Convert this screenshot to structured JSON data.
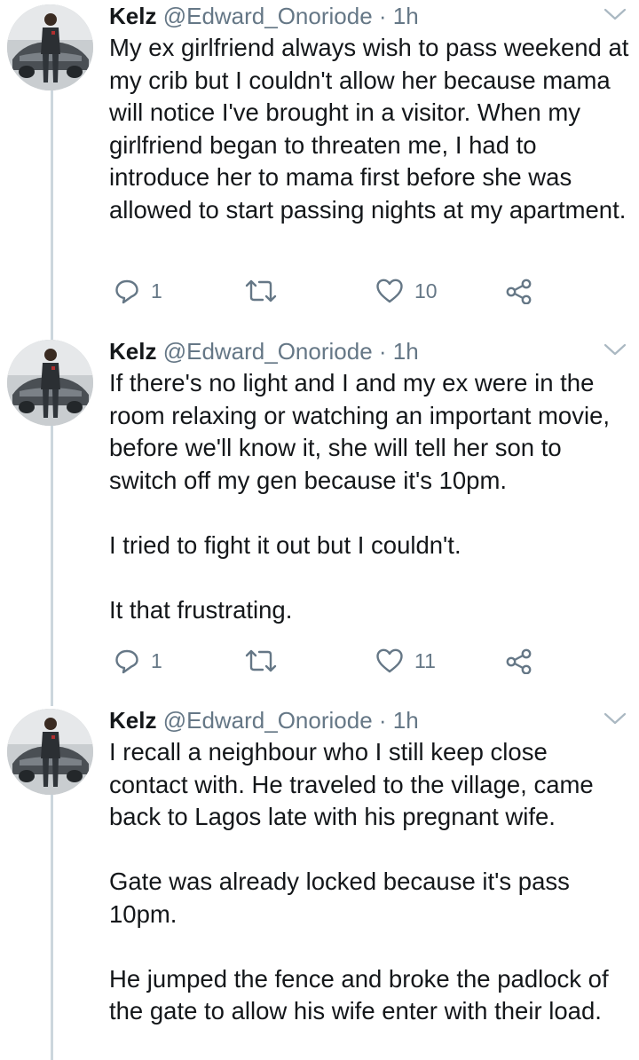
{
  "tweets": [
    {
      "author": {
        "name": "Kelz",
        "handle": "@Edward_Onoriode",
        "time": "· 1h"
      },
      "paragraphs": [
        "My ex girlfriend always wish to pass weekend at my crib but I couldn't allow her because mama will notice I've brought in a visitor. When my girlfriend began to threaten me, I had to introduce her to mama first before she was allowed to start passing nights at my apartment."
      ],
      "actions": {
        "reply_count": "1",
        "like_count": "10"
      }
    },
    {
      "author": {
        "name": "Kelz",
        "handle": "@Edward_Onoriode",
        "time": "· 1h"
      },
      "paragraphs": [
        "If there's no light and I and my ex were in the room relaxing or watching an important movie, before we'll know it, she will tell her son to switch off my gen because it's 10pm.",
        "I tried to fight it out but I couldn't.",
        "It that frustrating."
      ],
      "actions": {
        "reply_count": "1",
        "like_count": "11"
      }
    },
    {
      "author": {
        "name": "Kelz",
        "handle": "@Edward_Onoriode",
        "time": "· 1h"
      },
      "paragraphs": [
        "I recall a neighbour who I still keep close contact with. He traveled to the village, came back to Lagos late with his pregnant wife.",
        "Gate was already locked because it's pass 10pm.",
        "He jumped the fence and broke the padlock of the gate to allow his wife enter with their load."
      ]
    }
  ],
  "icons": {
    "reply": "reply-icon",
    "retweet": "retweet-icon",
    "like": "heart-icon",
    "share": "share-icon",
    "menu": "chevron-down-icon"
  },
  "colors": {
    "text": "#14171a",
    "secondary": "#657786",
    "thread_line": "#ccd6dd",
    "caret": "#aab8c2"
  }
}
